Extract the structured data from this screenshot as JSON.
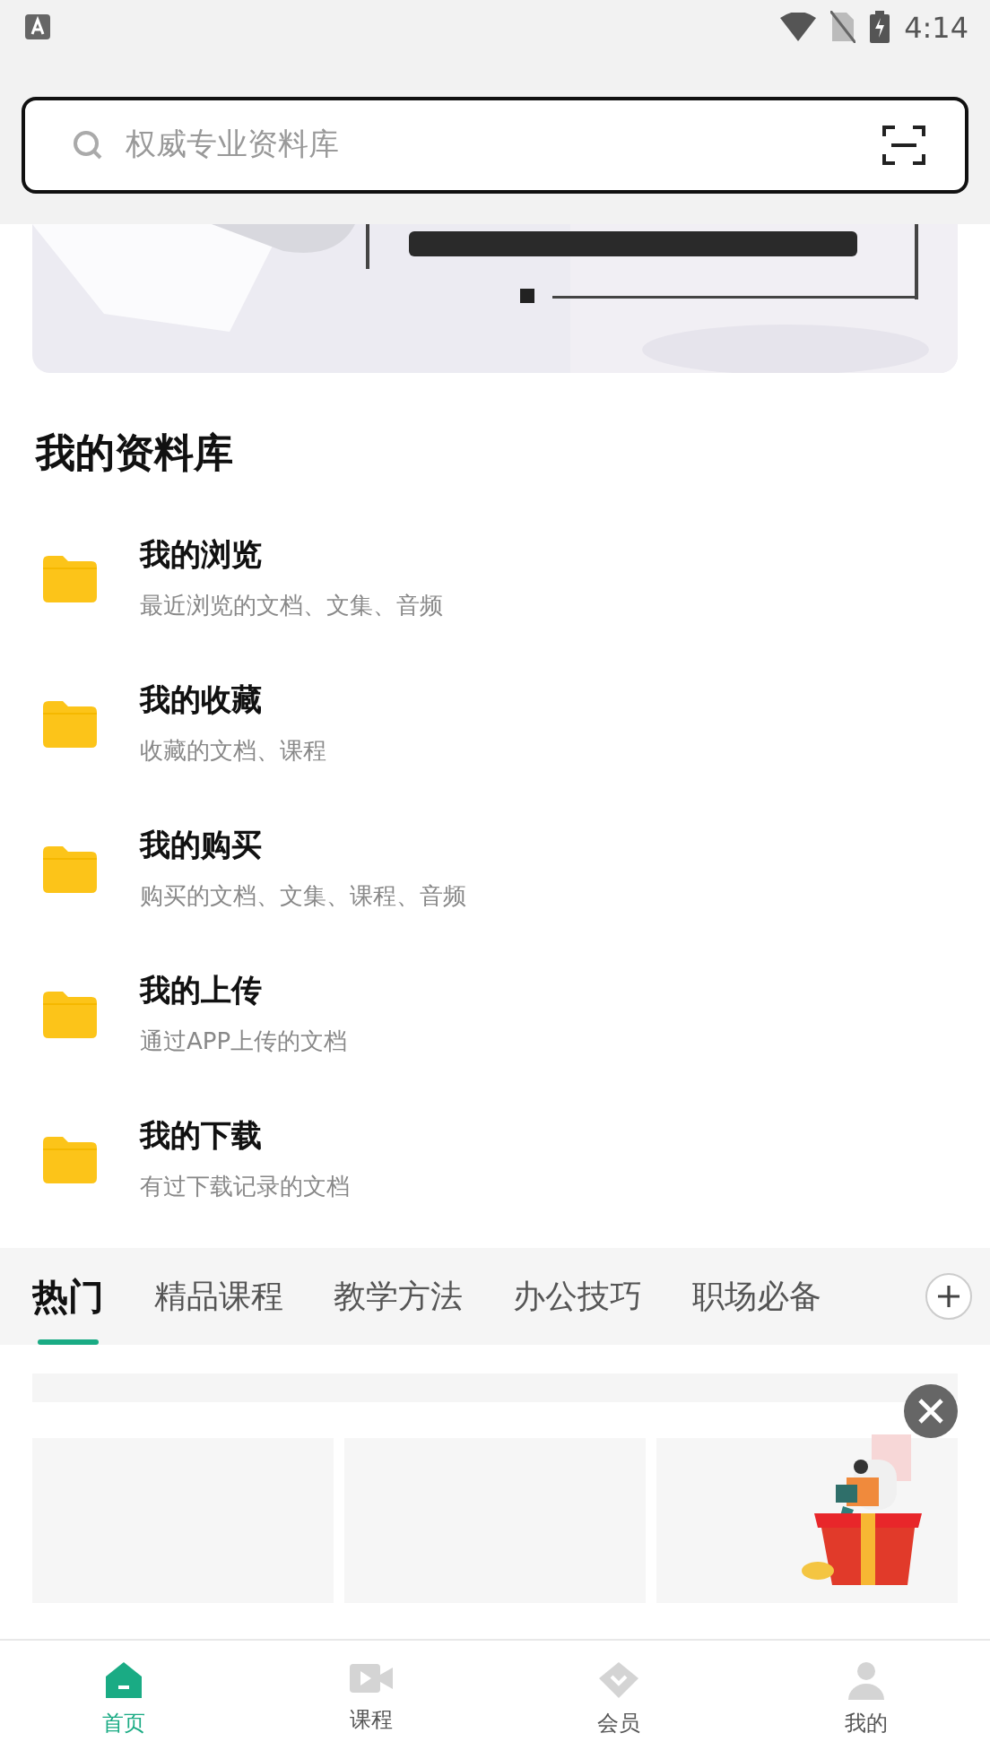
{
  "status_bar": {
    "time": "4:14"
  },
  "search": {
    "placeholder": "权威专业资料库"
  },
  "library": {
    "title": "我的资料库",
    "items": [
      {
        "title": "我的浏览",
        "subtitle": "最近浏览的文档、文集、音频"
      },
      {
        "title": "我的收藏",
        "subtitle": "收藏的文档、课程"
      },
      {
        "title": "我的购买",
        "subtitle": "购买的文档、文集、课程、音频"
      },
      {
        "title": "我的上传",
        "subtitle": "通过APP上传的文档"
      },
      {
        "title": "我的下载",
        "subtitle": "有过下载记录的文档"
      }
    ]
  },
  "tabs": [
    {
      "label": "热门",
      "selected": true
    },
    {
      "label": "精品课程",
      "selected": false
    },
    {
      "label": "教学方法",
      "selected": false
    },
    {
      "label": "办公技巧",
      "selected": false
    },
    {
      "label": "职场必备",
      "selected": false
    }
  ],
  "bottom_nav": [
    {
      "label": "首页",
      "kind": "home",
      "selected": true
    },
    {
      "label": "课程",
      "kind": "video",
      "selected": false
    },
    {
      "label": "会员",
      "kind": "vip",
      "selected": false
    },
    {
      "label": "我的",
      "kind": "user",
      "selected": false
    }
  ]
}
